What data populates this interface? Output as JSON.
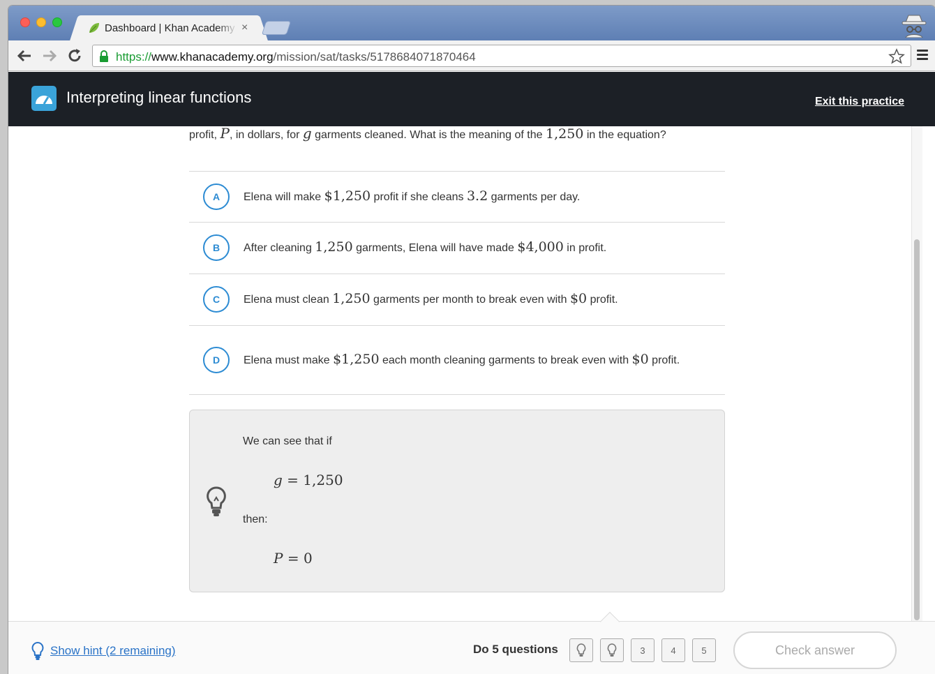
{
  "browser": {
    "tab_title": "Dashboard | Khan Academy",
    "tab_close": "×",
    "url_scheme": "https://",
    "url_host": "www.khanacademy.org",
    "url_path": "/mission/sat/tasks/5178684071870464"
  },
  "header": {
    "title": "Interpreting linear functions",
    "exit_label": "Exit this practice"
  },
  "question": {
    "text_before_P": "profit, ",
    "var_P": "P",
    "text_mid": ", in dollars, for ",
    "var_g": "g",
    "text_after_g": " garments cleaned. What is the meaning of the ",
    "num": "1,250",
    "text_end": " in the equation?"
  },
  "choices": [
    {
      "letter": "A",
      "parts": [
        "Elena will make ",
        "$1,250",
        " profit if she cleans ",
        "3.2",
        " garments per day."
      ]
    },
    {
      "letter": "B",
      "parts": [
        "After cleaning ",
        "1,250",
        " garments, Elena will have made ",
        "$4,000",
        " in profit."
      ]
    },
    {
      "letter": "C",
      "parts": [
        "Elena must clean ",
        "1,250",
        " garments per month to break even with ",
        "$0",
        " profit."
      ]
    },
    {
      "letter": "D",
      "parts": [
        "Elena must make ",
        "$1,250",
        " each month cleaning garments to break even with ",
        "$0",
        " profit."
      ]
    }
  ],
  "hint": {
    "line1": "We can see that if",
    "eq1_var": "g",
    "eq1_rest": " = 1,250",
    "line2": "then:",
    "eq2_var": "P",
    "eq2_rest": " = 0"
  },
  "footer": {
    "show_hint": "Show hint (2 remaining)",
    "do_questions": "Do 5 questions",
    "question_boxes": [
      "3",
      "4",
      "5"
    ],
    "check_answer": "Check answer"
  },
  "colors": {
    "accent_blue": "#2c8bd3",
    "header_dark": "#1c2026",
    "logo_blue": "#3aa3d9",
    "url_green": "#1a9c33"
  }
}
